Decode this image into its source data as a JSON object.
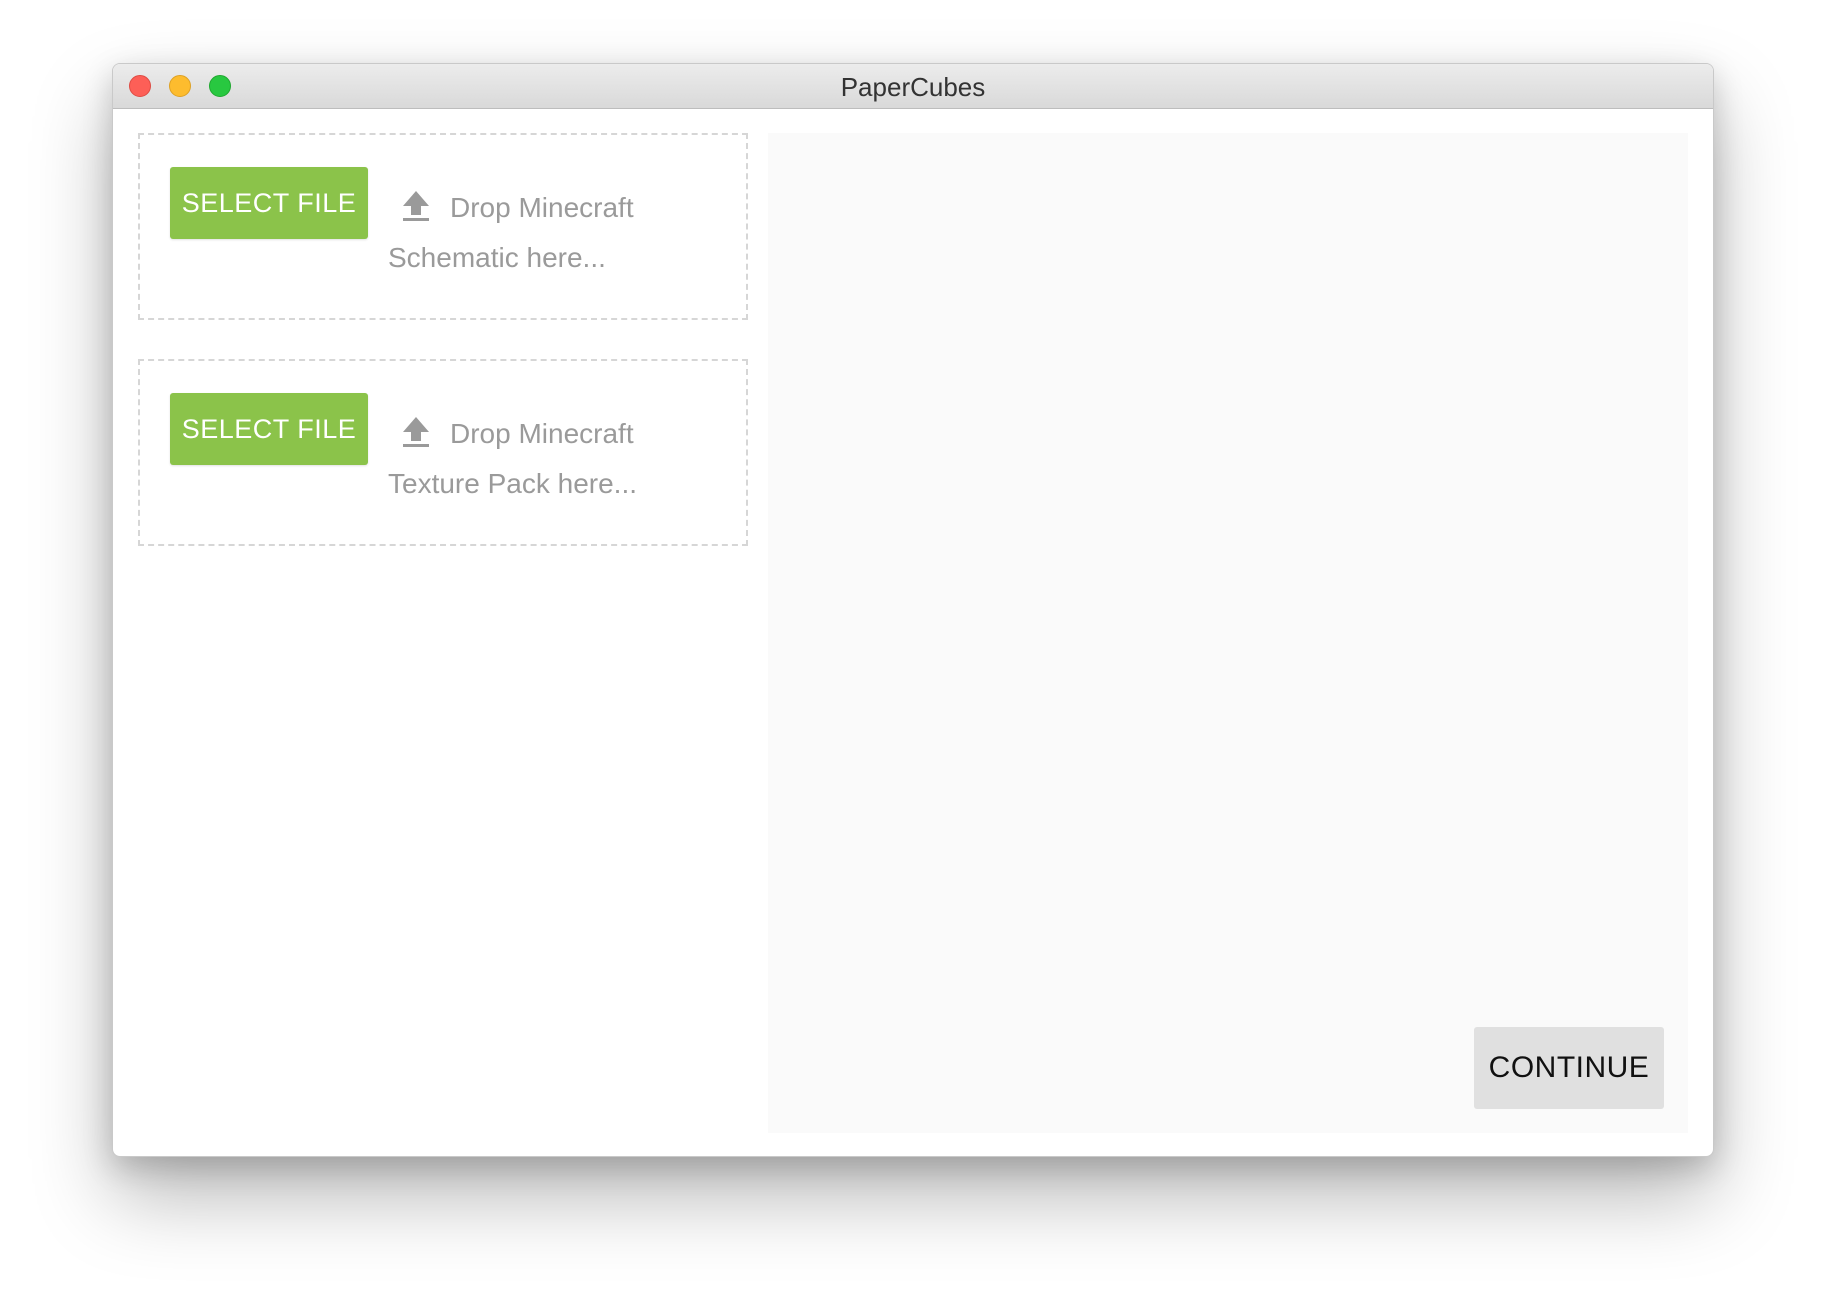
{
  "window": {
    "title": "PaperCubes"
  },
  "dropzones": [
    {
      "button_label": "SELECT FILE",
      "text_line1": "Drop Minecraft",
      "text_line2": "Schematic here..."
    },
    {
      "button_label": "SELECT FILE",
      "text_line1": "Drop Minecraft",
      "text_line2": "Texture Pack here..."
    }
  ],
  "preview": {
    "continue_label": "CONTINUE"
  },
  "icons": {
    "upload": "upload-icon"
  },
  "colors": {
    "accent_green": "#8bc34a",
    "drop_text": "#9a9a9a",
    "continue_bg": "#e0e0e0",
    "preview_bg": "#fafafa"
  }
}
